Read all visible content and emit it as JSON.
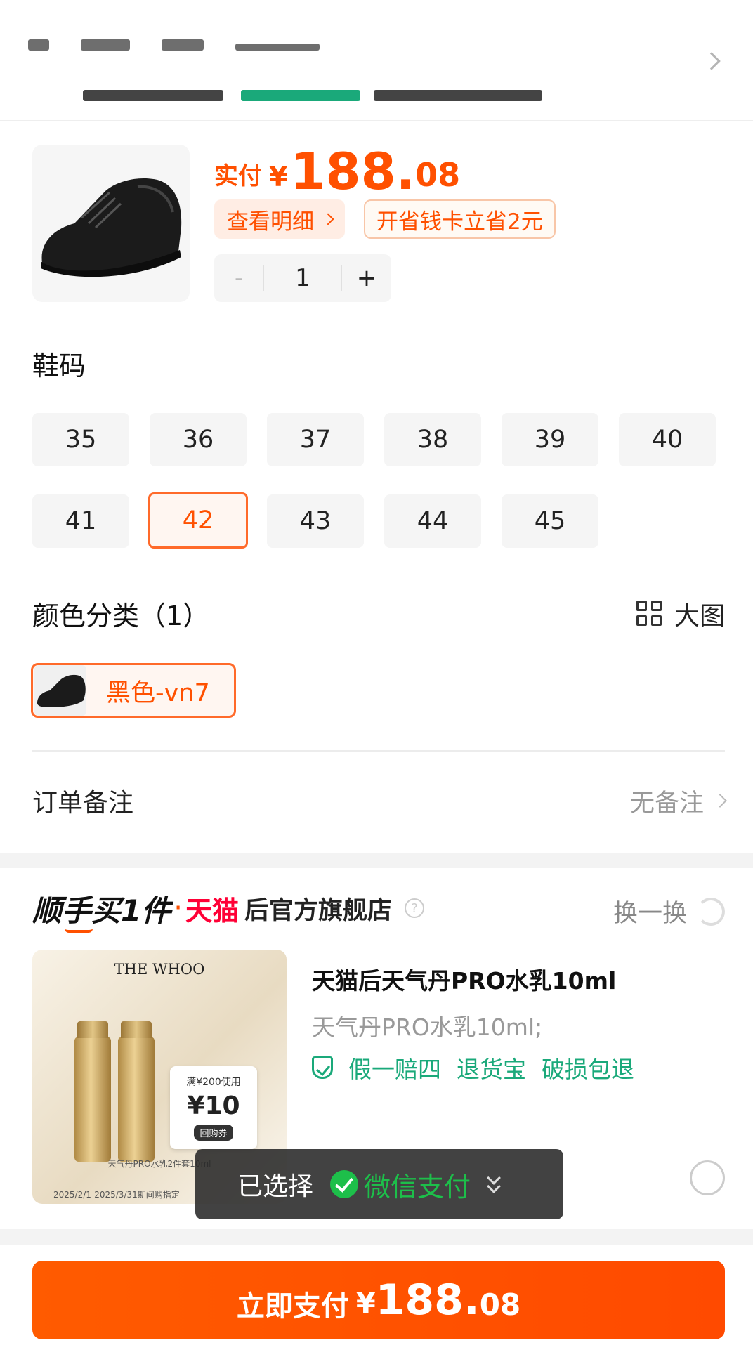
{
  "product": {
    "price_label": "实付",
    "currency": "¥",
    "price_int": "188.",
    "price_dec": "08",
    "detail_label": "查看明细",
    "save_card_label": "开省钱卡立省2元",
    "quantity": "1",
    "minus": "-",
    "plus": "+"
  },
  "size": {
    "label": "鞋码",
    "options": [
      "35",
      "36",
      "37",
      "38",
      "39",
      "40",
      "41",
      "42",
      "43",
      "44",
      "45"
    ],
    "selected": "42"
  },
  "color": {
    "label": "颜色分类（1）",
    "big_image_label": "大图",
    "option": "黑色-vn7"
  },
  "note": {
    "label": "订单备注",
    "value": "无备注"
  },
  "recommend": {
    "title": "顺手买1件",
    "dot": "·",
    "tmall": "天猫",
    "shop": "后官方旗舰店",
    "swap_label": "换一换",
    "image_brand": "THE WHOO",
    "coupon_condition": "满¥200使用",
    "coupon_value": "¥10",
    "coupon_tag": "回购券",
    "image_caption": "天气丹PRO水乳2件套10ml",
    "image_date": "2025/2/1-2025/3/31期间购指定",
    "name": "天猫后天气丹PRO水乳10ml",
    "spec": "天气丹PRO水乳10ml;",
    "tags": [
      "假一赔四",
      "退货宝",
      "破损包退"
    ]
  },
  "payment": {
    "selected_label": "已选择",
    "method": "微信支付"
  },
  "pay_button": {
    "label": "立即支付",
    "currency": "¥",
    "amount_int": "188.",
    "amount_dec": "08"
  },
  "colors": {
    "accent": "#ff5000",
    "green": "#1aa97a",
    "wechat": "#1dbf4a"
  }
}
